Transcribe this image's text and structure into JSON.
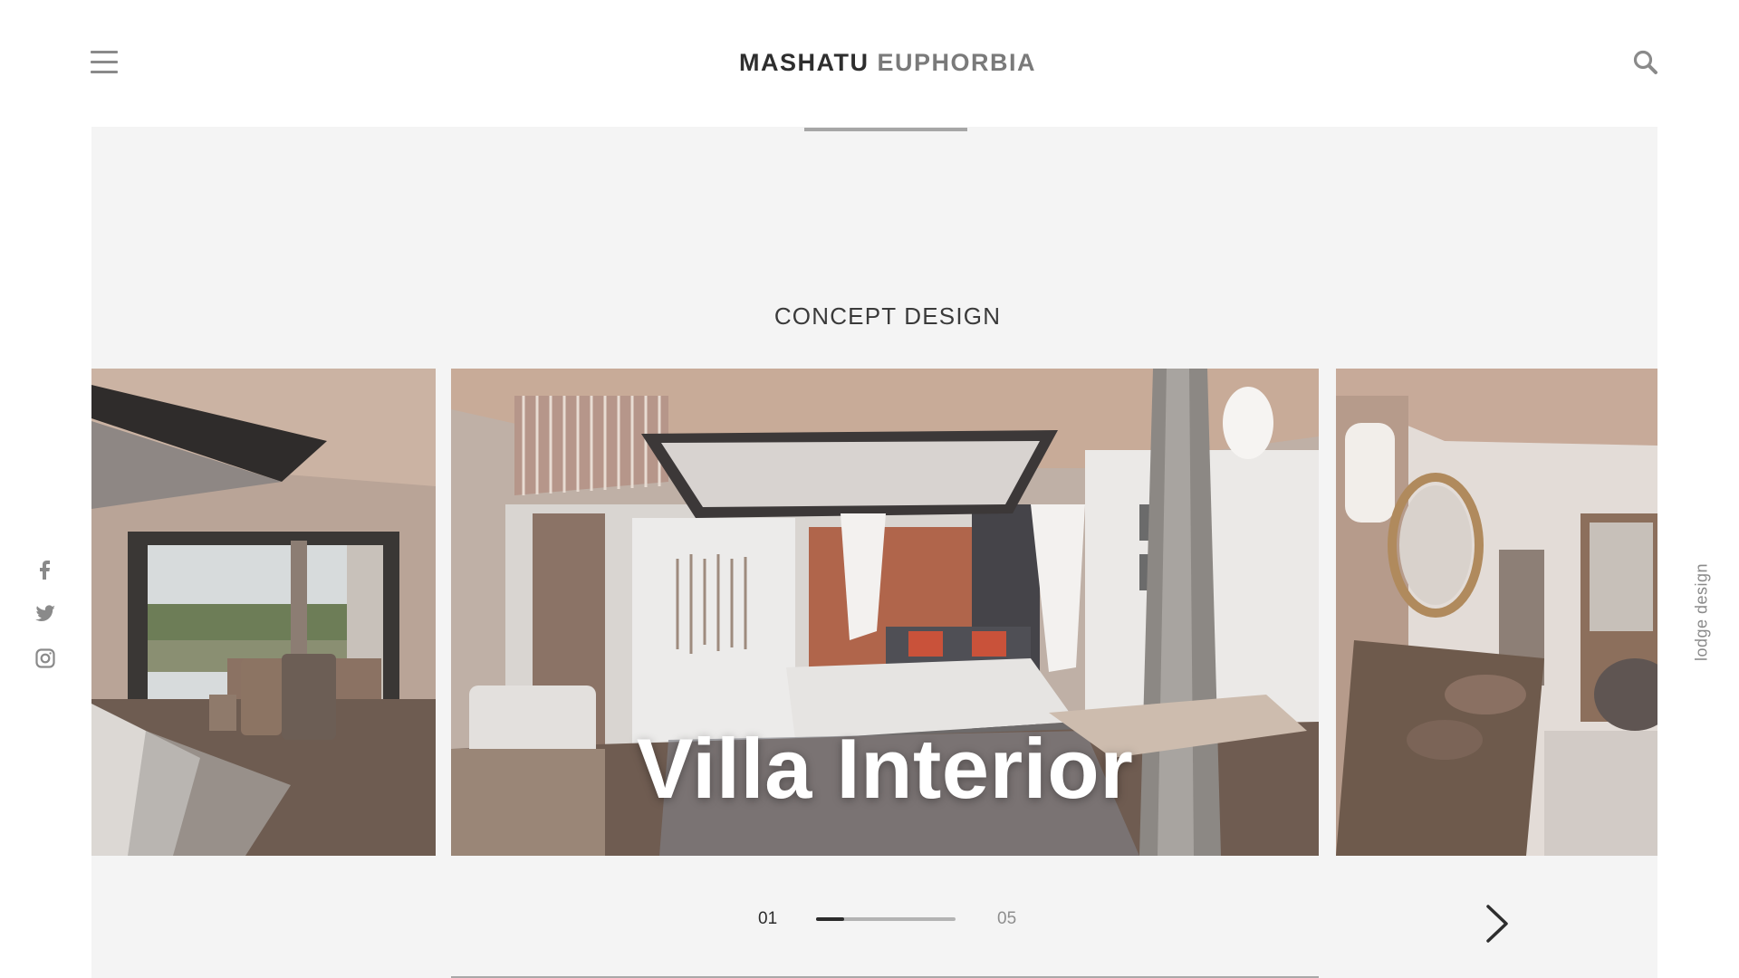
{
  "header": {
    "brand_primary": "MASHATU",
    "brand_secondary": "EUPHORBIA",
    "menu_icon": "hamburger-menu-icon",
    "search_icon": "search-icon"
  },
  "section": {
    "title": "CONCEPT DESIGN"
  },
  "slider": {
    "slides": [
      {
        "caption": ""
      },
      {
        "caption": "Villa Interior"
      },
      {
        "caption": ""
      }
    ],
    "current": "01",
    "total": "05",
    "progress_fraction": 0.2,
    "next_icon": "chevron-right-icon"
  },
  "social": [
    {
      "icon": "facebook-icon"
    },
    {
      "icon": "twitter-icon"
    },
    {
      "icon": "instagram-icon"
    }
  ],
  "side_label": "lodge design",
  "colors": {
    "brand_dark": "#2e2e2e",
    "brand_light": "#7a7a7a",
    "panel_bg": "#f4f4f4",
    "muted": "#8a8a8a"
  }
}
